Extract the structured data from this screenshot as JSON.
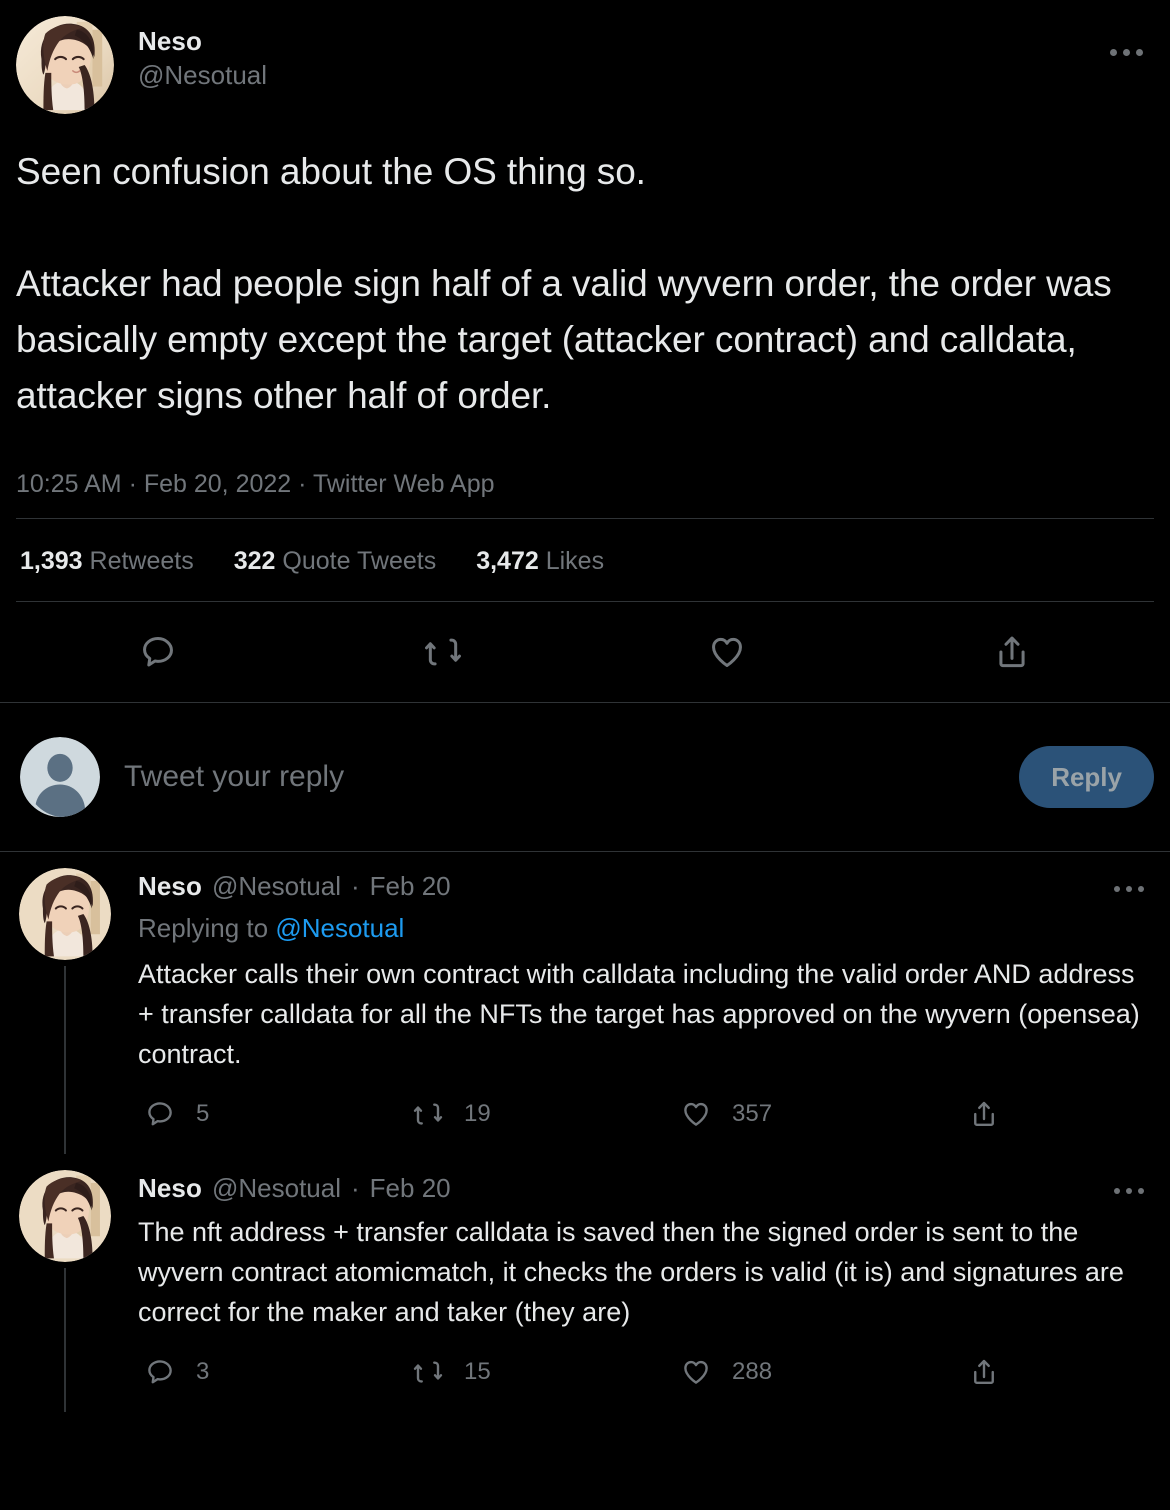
{
  "theme": {
    "background": "#000000",
    "text_primary": "#e7e9ea",
    "text_secondary": "#71767b",
    "accent_blue": "#1d9bf0",
    "reply_button_bg": "#2b5278",
    "reply_button_text": "#9aa3a8",
    "divider": "#2f3336"
  },
  "main_tweet": {
    "display_name": "Neso",
    "handle": "@Nesotual",
    "more_icon": "more-horizontal-icon",
    "text": "Seen confusion about the OS thing so.\n\nAttacker had people sign half of a valid wyvern order, the order was basically empty except the target (attacker contract) and calldata, attacker signs other half of order.",
    "timestamp": "10:25 AM · Feb 20, 2022 · Twitter Web App",
    "stats": {
      "retweets_count": "1,393",
      "retweets_label": "Retweets",
      "quotes_count": "322",
      "quotes_label": "Quote Tweets",
      "likes_count": "3,472",
      "likes_label": "Likes"
    },
    "actions": [
      {
        "name": "reply-icon",
        "label": ""
      },
      {
        "name": "retweet-icon",
        "label": ""
      },
      {
        "name": "like-icon",
        "label": ""
      },
      {
        "name": "share-icon",
        "label": ""
      }
    ]
  },
  "composer": {
    "avatar": "default-avatar-icon",
    "placeholder": "Tweet your reply",
    "button_label": "Reply"
  },
  "replies": [
    {
      "display_name": "Neso",
      "handle": "@Nesotual",
      "separator": "·",
      "date": "Feb 20",
      "replying_to_prefix": "Replying to ",
      "replying_to_mention": "@Nesotual",
      "text": "Attacker calls their own contract with calldata including the valid order AND address + transfer calldata for all the NFTs the target has approved on the wyvern (opensea) contract.",
      "stats": {
        "replies": "5",
        "retweets": "19",
        "likes": "357",
        "shares": ""
      }
    },
    {
      "display_name": "Neso",
      "handle": "@Nesotual",
      "separator": "·",
      "date": "Feb 20",
      "replying_to_prefix": "",
      "replying_to_mention": "",
      "text": "The nft address + transfer calldata is saved then the signed order is sent to the wyvern contract atomicmatch, it checks the orders is valid (it is) and signatures are correct for the maker and taker (they are)",
      "stats": {
        "replies": "3",
        "retweets": "15",
        "likes": "288",
        "shares": ""
      }
    }
  ]
}
